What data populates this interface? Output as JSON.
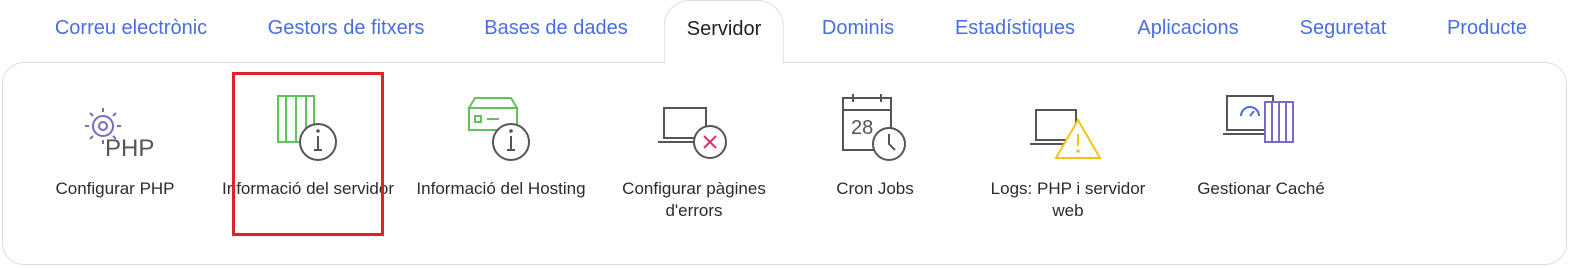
{
  "tabs": [
    {
      "label": "Correu electrònic",
      "active": false
    },
    {
      "label": "Gestors de fitxers",
      "active": false
    },
    {
      "label": "Bases de dades",
      "active": false
    },
    {
      "label": "Servidor",
      "active": true
    },
    {
      "label": "Dominis",
      "active": false
    },
    {
      "label": "Estadístiques",
      "active": false
    },
    {
      "label": "Aplicacions",
      "active": false
    },
    {
      "label": "Seguretat",
      "active": false
    },
    {
      "label": "Producte",
      "active": false
    }
  ],
  "tools": [
    {
      "label": "Configurar PHP",
      "icon": "php-gear-icon"
    },
    {
      "label": "Informació del servidor",
      "icon": "server-info-icon"
    },
    {
      "label": "Informació del Hosting",
      "icon": "hosting-info-icon"
    },
    {
      "label": "Configurar pàgines d'errors",
      "icon": "error-page-icon"
    },
    {
      "label": "Cron Jobs",
      "icon": "calendar-clock-icon"
    },
    {
      "label": "Logs: PHP i servidor web",
      "icon": "warning-log-icon"
    },
    {
      "label": "Gestionar Caché",
      "icon": "cache-gauge-icon"
    }
  ],
  "icon_text": {
    "php": "PHP",
    "calendar_day": "28"
  },
  "colors": {
    "tab_link": "#4a6ee0",
    "highlight": "#e0202a",
    "icon_purple": "#7b6bc6",
    "icon_green": "#5fc25a",
    "icon_pink": "#e0306a",
    "icon_yellow": "#f0c419"
  }
}
